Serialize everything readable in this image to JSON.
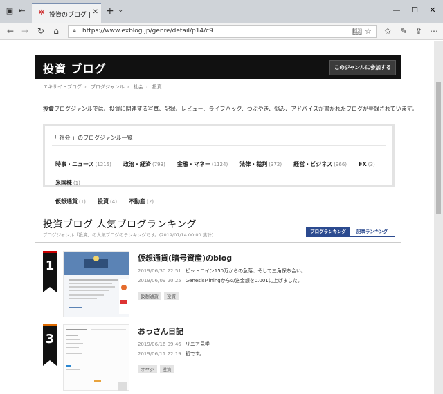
{
  "browser": {
    "tab_title": "投資のブログ | エキサイトブ",
    "url": "https://www.exblog.jp/genre/detail/p14/c9"
  },
  "hero": {
    "title": "投資 ブログ",
    "join_button": "このジャンルに参加する"
  },
  "breadcrumb": [
    "エキサイトブログ",
    "ブログジャンル",
    "社会",
    "投資"
  ],
  "description": {
    "bold": "投資",
    "text": "ブログジャンルでは、投資に関連する写真、記録、レビュー、ライフハック、つぶやき、悩み、アドバイスが書かれたブログが登録されています。"
  },
  "genre_box": {
    "heading": "「 社会 」のブログジャンル一覧",
    "items": [
      {
        "label": "時事・ニュース",
        "count": "(1215)"
      },
      {
        "label": "政治・経済",
        "count": "(793)"
      },
      {
        "label": "金融・マネー",
        "count": "(1124)"
      },
      {
        "label": "法律・裁判",
        "count": "(372)"
      },
      {
        "label": "経営・ビジネス",
        "count": "(966)"
      },
      {
        "label": "FX",
        "count": "(3)"
      },
      {
        "label": "米国株",
        "count": "(1)"
      },
      {
        "label": "仮想通貨",
        "count": "(1)"
      },
      {
        "label": "投資",
        "count": "(4)"
      },
      {
        "label": "不動産",
        "count": "(2)"
      }
    ]
  },
  "ranking": {
    "title": "投資ブログ 人気ブログランキング",
    "subtitle": "ブログジャンル「投資」の人気ブログのランキングです。(2019/07/14 00:00 集計)",
    "tab_blog": "ブログランキング",
    "tab_article": "記事ランキング",
    "entries": [
      {
        "rank": "1",
        "title": "仮想通貨(暗号資産)のblog",
        "posts": [
          {
            "date": "2019/06/30 22:51",
            "text": "ビットコイン150万からの急落、そして三角保ち合い。"
          },
          {
            "date": "2019/06/09 20:25",
            "text": "GenesisMiningからの送金額を0.001に上げました。"
          }
        ],
        "tags": [
          "仮想通貨",
          "投資"
        ]
      },
      {
        "rank": "3",
        "title": "おっさん日記",
        "posts": [
          {
            "date": "2019/06/16 09:46",
            "text": "リニア見学"
          },
          {
            "date": "2019/06/11 22:19",
            "text": "初です。"
          }
        ],
        "tags": [
          "オヤジ",
          "投資"
        ]
      }
    ]
  },
  "colors": {
    "hero_bg": "#111111",
    "accent_blue": "#2b4a8f",
    "rank_red": "#cc0000",
    "rank_orange": "#e06b00"
  }
}
